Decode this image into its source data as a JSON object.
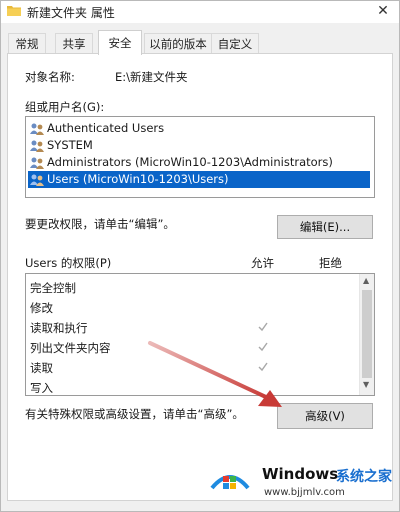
{
  "window": {
    "title": "新建文件夹 属性",
    "close_glyph": "✕"
  },
  "tabs": [
    {
      "label": "常规"
    },
    {
      "label": "共享"
    },
    {
      "label": "安全",
      "active": true
    },
    {
      "label": "以前的版本"
    },
    {
      "label": "自定义"
    }
  ],
  "object": {
    "label": "对象名称:",
    "value": "E:\\新建文件夹"
  },
  "groups": {
    "label": "组或用户名(G):",
    "items": [
      {
        "name": "Authenticated Users",
        "selected": false
      },
      {
        "name": "SYSTEM",
        "selected": false
      },
      {
        "name": "Administrators (MicroWin10-1203\\Administrators)",
        "selected": false
      },
      {
        "name": "Users (MicroWin10-1203\\Users)",
        "selected": true
      }
    ]
  },
  "change_hint": "要更改权限，请单击“编辑”。",
  "edit_button": "编辑(E)...",
  "permissions": {
    "title": "Users 的权限(P)",
    "allow_header": "允许",
    "deny_header": "拒绝",
    "items": [
      {
        "name": "完全控制",
        "allow": false,
        "deny": false
      },
      {
        "name": "修改",
        "allow": false,
        "deny": false
      },
      {
        "name": "读取和执行",
        "allow": true,
        "deny": false
      },
      {
        "name": "列出文件夹内容",
        "allow": true,
        "deny": false
      },
      {
        "name": "读取",
        "allow": true,
        "deny": false
      },
      {
        "name": "写入",
        "allow": false,
        "deny": false
      }
    ]
  },
  "advanced_hint": "有关特殊权限或高级设置，请单击“高级”。",
  "advanced_button": "高级(V)",
  "watermark": {
    "brand": "Windows",
    "brand_cn": "系统之家",
    "url": "www.bjjmlv.com"
  },
  "colors": {
    "selection": "#0a64c8",
    "annotation_arrow": "#c83a36",
    "checkmark": "#a8a8a8"
  }
}
